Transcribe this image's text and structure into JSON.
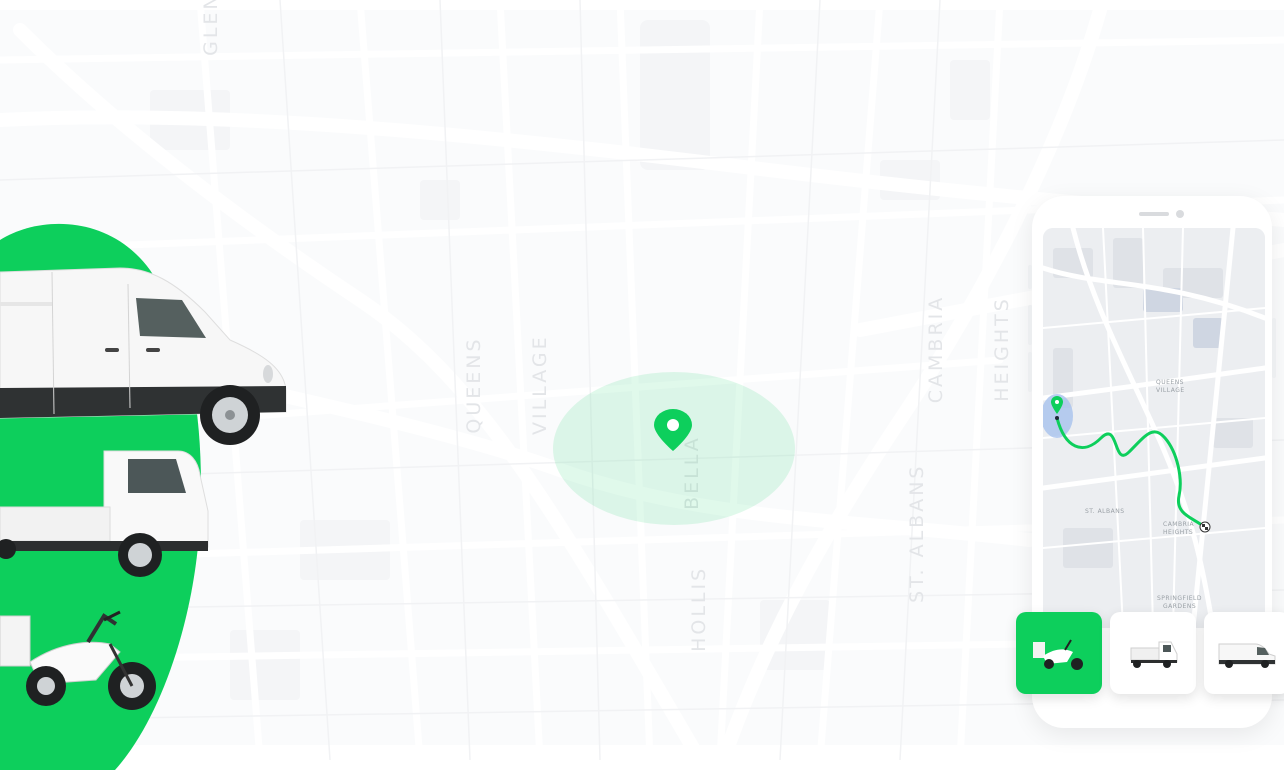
{
  "map": {
    "neighborhood_labels": [
      {
        "id": "glen",
        "lines": [
          "GLEN"
        ]
      },
      {
        "id": "queens-village",
        "lines": [
          "QUEENS",
          "VILLAGE"
        ]
      },
      {
        "id": "cambria-heights",
        "lines": [
          "CAMBRIA",
          "HEIGHTS"
        ]
      },
      {
        "id": "bellaire",
        "lines": [
          "BELLA"
        ]
      },
      {
        "id": "hollis",
        "lines": [
          "HOLLIS"
        ]
      },
      {
        "id": "st-albans",
        "lines": [
          "ST. ALBANS"
        ]
      }
    ],
    "accent_color": "#0dcf5c"
  },
  "hero": {
    "blob_color": "#0dcf5c",
    "vehicles": [
      "cargo-van",
      "flatbed-truck",
      "cargo-tricycle"
    ]
  },
  "phone": {
    "mini_map_labels": {
      "queens_village": [
        "QUEENS",
        "VILLAGE"
      ],
      "st_albans": [
        "ST. ALBANS"
      ],
      "cambria_heights": [
        "CAMBRIA",
        "HEIGHTS"
      ],
      "springfield_gardens": [
        "SPRINGFIELD",
        "GARDENS"
      ]
    },
    "route_color": "#0dcf5c"
  },
  "vehicle_types": [
    {
      "name": "cargo-tricycle",
      "selected": true
    },
    {
      "name": "flatbed-truck",
      "selected": false
    },
    {
      "name": "cargo-van",
      "selected": false
    }
  ]
}
